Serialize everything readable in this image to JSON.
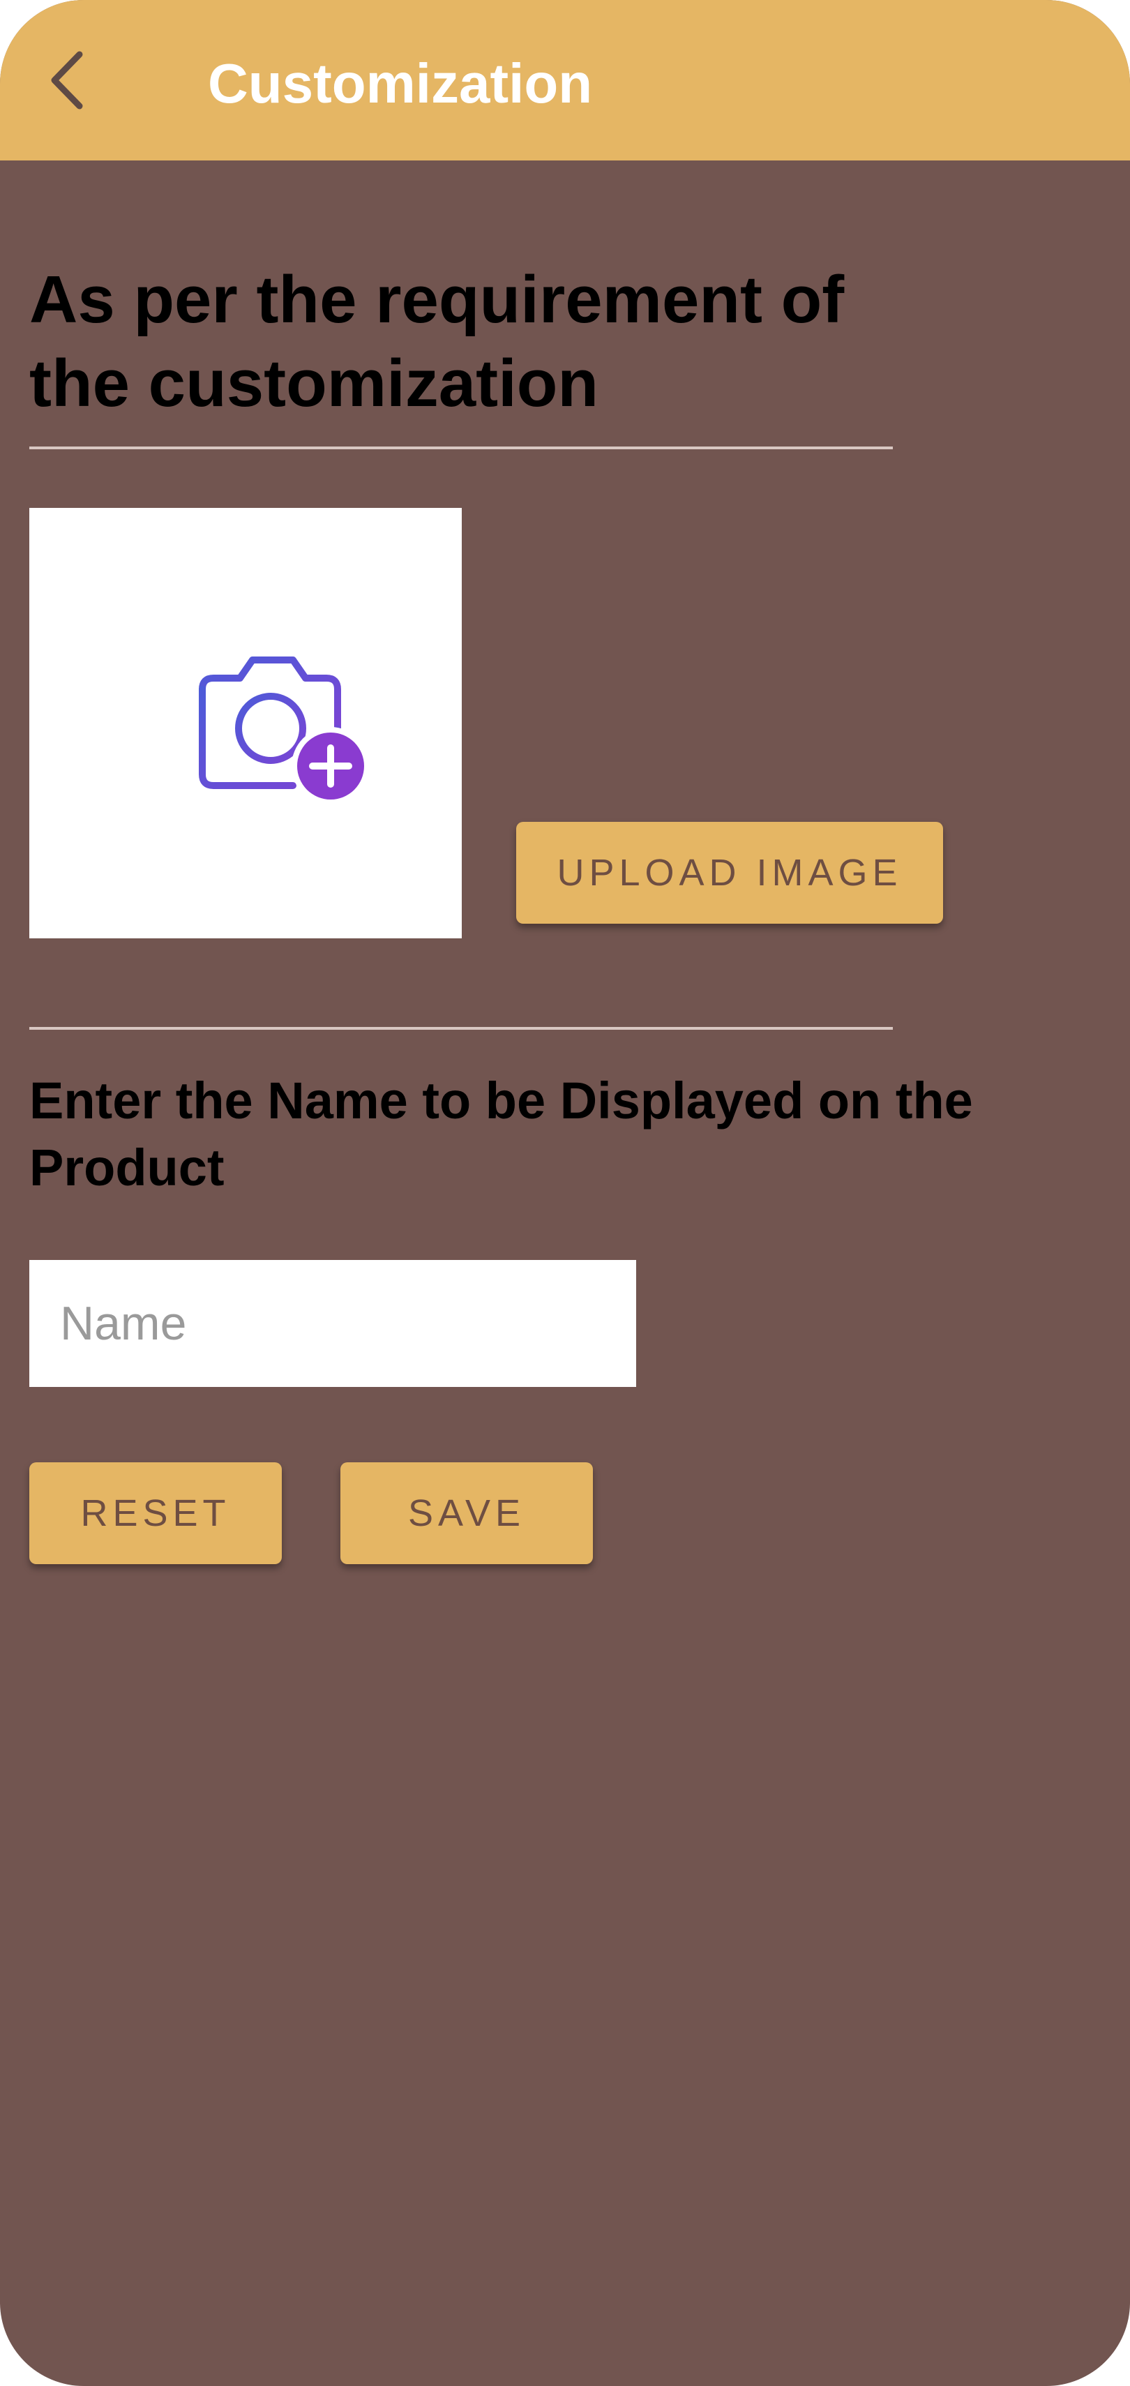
{
  "app_bar": {
    "title": "Customization",
    "back_icon": "chevron-left-icon",
    "background_color": "#e5b664"
  },
  "content": {
    "heading": "As per the requirement of the customization",
    "image_placeholder_icon": "add-photo-icon",
    "upload_button_label": "UPLOAD IMAGE",
    "name_label": "Enter the Name to be Displayed on the Product",
    "name_input": {
      "value": "",
      "placeholder": "Name"
    },
    "reset_button_label": "RESET",
    "save_button_label": "SAVE"
  },
  "colors": {
    "background": "#725550",
    "accent": "#e5b664",
    "button_text": "#6e4e42",
    "icon_stroke": "#5a4fd6",
    "icon_plus": "#8a3bd0"
  }
}
